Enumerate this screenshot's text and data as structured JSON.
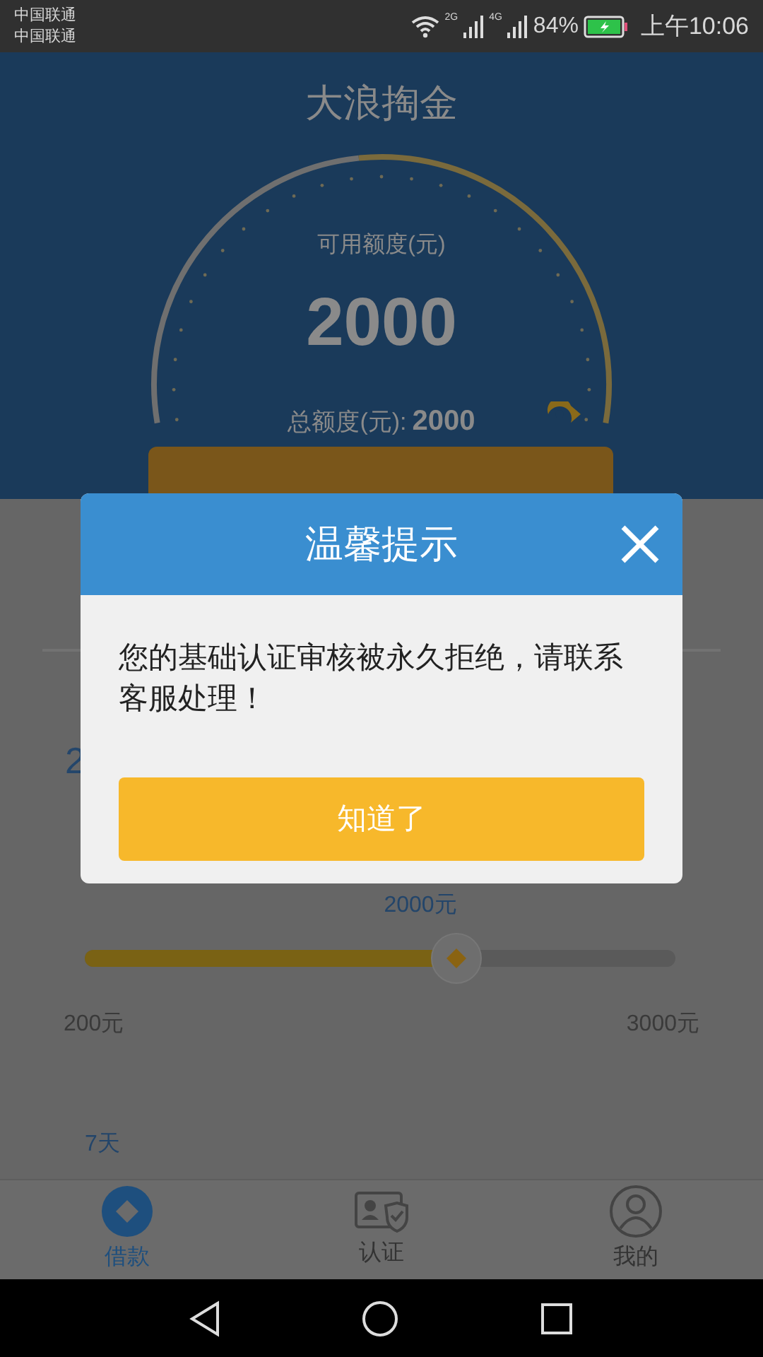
{
  "status_bar": {
    "carriers": [
      "中国联通",
      "中国联通"
    ],
    "network_1": "2G",
    "network_2": "4G",
    "battery": "84%",
    "time": "上午10:06"
  },
  "header": {
    "title": "大浪掏金",
    "available_label": "可用额度(元)",
    "available_amount": "2000",
    "total_label": "总额度(元):",
    "total_amount": "2000"
  },
  "amount_fragment": "2",
  "slider": {
    "value_label": "2000元",
    "level": 0.63,
    "min_label": "200元",
    "max_label": "3000元"
  },
  "term": "7天",
  "tabs": [
    {
      "label": "借款",
      "kind": "coin",
      "selected": true
    },
    {
      "label": "认证",
      "kind": "card",
      "selected": false
    },
    {
      "label": "我的",
      "kind": "user",
      "selected": false
    }
  ],
  "dialog": {
    "title": "温馨提示",
    "message": "您的基础认证审核被永久拒绝，请联系客服处理！",
    "button": "知道了"
  }
}
